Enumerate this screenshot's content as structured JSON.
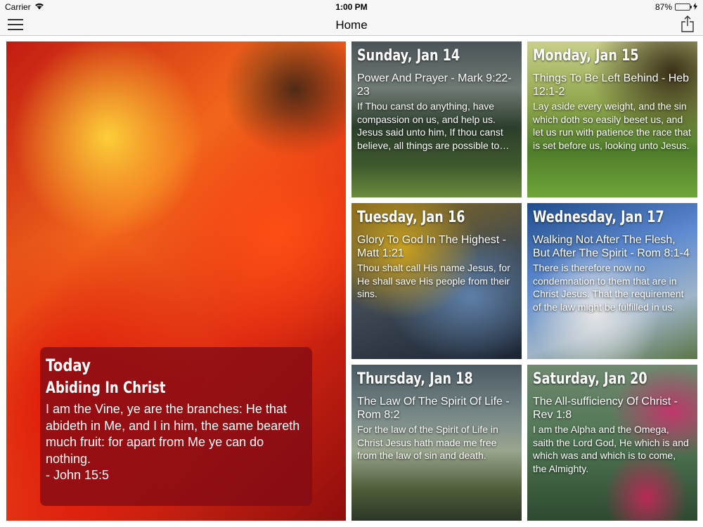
{
  "status_bar": {
    "carrier": "Carrier",
    "time": "1:00 PM",
    "battery_percent": "87%",
    "battery_level": 0.87
  },
  "nav": {
    "title": "Home"
  },
  "today": {
    "label": "Today",
    "title": "Abiding In Christ",
    "text": "I am the Vine, ye are the branches: He that abideth in Me, and I in him, the same beareth much fruit: for apart from Me ye can do nothing.",
    "reference": "- John 15:5"
  },
  "tiles": [
    {
      "date": "Sunday, Jan 14",
      "title": "Power And Prayer - Mark 9:22-23",
      "text": "If Thou canst do anything, have compassion on us, and help us. Jesus said unto him, If thou canst believe, all things are possible to him that believeth."
    },
    {
      "date": "Monday, Jan 15",
      "title": "Things To Be Left Behind - Heb 12:1-2",
      "text": "Lay aside every weight, and the sin which doth so easily beset us, and let us run with patience the race that is set before us, looking unto Jesus."
    },
    {
      "date": "Tuesday, Jan 16",
      "title": "Glory To God In The Highest - Matt 1:21",
      "text": "Thou shalt call His name Jesus, for He shall save His people from their sins."
    },
    {
      "date": "Wednesday, Jan 17",
      "title": "Walking Not After The Flesh, But After The Spirit - Rom 8:1-4",
      "text": "There is therefore now no condemnation to them that are in Christ Jesus. That the requirement of the law might be fulfilled in us."
    },
    {
      "date": "Thursday, Jan 18",
      "title": "The Law Of The Spirit Of Life - Rom 8:2",
      "text": "For the law of the Spirit of Life in Christ Jesus hath made me free from the law of sin and death."
    },
    {
      "date": "Saturday, Jan 20",
      "title": "The All-sufficiency Of Christ - Rev 1:8",
      "text": "I am the Alpha and the Omega, saith the Lord God, He which is and which was and which is to come, the Almighty."
    }
  ]
}
